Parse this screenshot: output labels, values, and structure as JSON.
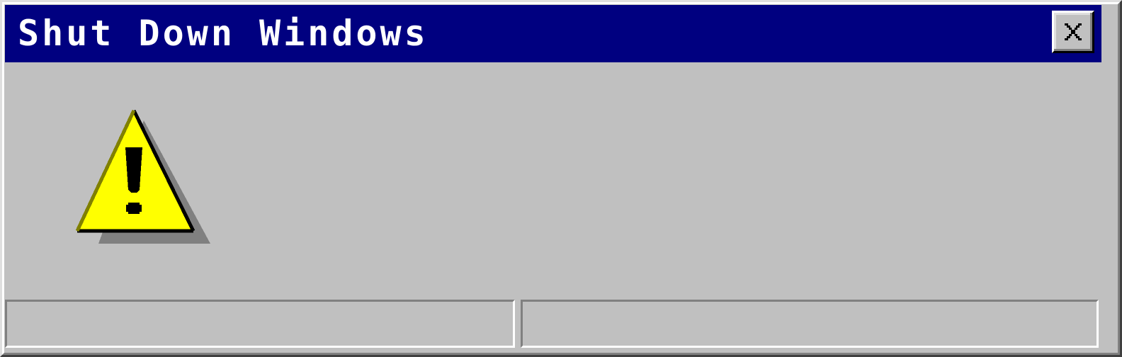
{
  "window": {
    "title": "Shut Down Windows",
    "close_label": "Close"
  },
  "icons": {
    "close": "close-icon",
    "warning": "warning-icon"
  },
  "status_bar": {
    "left_text": "",
    "right_text": ""
  },
  "colors": {
    "titlebar": "#000080",
    "face": "#c0c0c0",
    "warning_fill": "#ffff00"
  }
}
